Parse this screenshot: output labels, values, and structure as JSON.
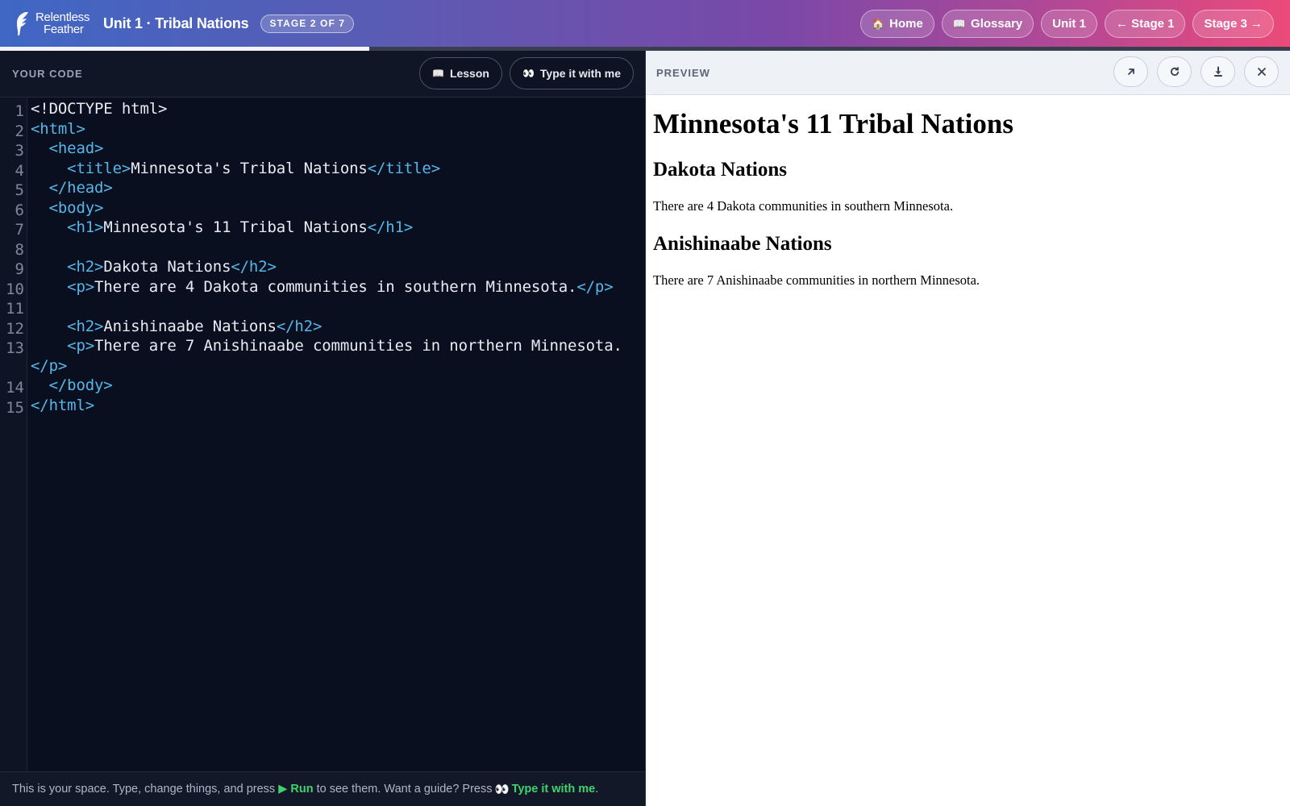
{
  "header": {
    "logo_line1": "Relentless",
    "logo_line2": "Feather",
    "unit_title": "Unit 1 · Tribal Nations",
    "stage_badge": "STAGE 2 OF 7",
    "nav": [
      {
        "icon": "🏠",
        "icon_name": "home-icon",
        "label": "Home"
      },
      {
        "icon": "📖",
        "icon_name": "book-icon",
        "label": "Glossary"
      },
      {
        "icon": "",
        "icon_name": "",
        "label": "Unit 1"
      },
      {
        "icon": "",
        "icon_name": "",
        "label": "← Stage 1"
      },
      {
        "icon": "",
        "icon_name": "",
        "label": "Stage 3 →"
      }
    ],
    "progress_fraction": 0.286
  },
  "editor": {
    "title": "YOUR CODE",
    "buttons": [
      {
        "icon": "📖",
        "icon_name": "book-icon",
        "label": "Lesson"
      },
      {
        "icon": "👀",
        "icon_name": "eyes-icon",
        "label": "Type it with me"
      }
    ],
    "line_numbers": [
      "1",
      "2",
      "3",
      "4",
      "5",
      "6",
      "7",
      "8",
      "9",
      "10",
      "11",
      "12",
      "13",
      "14",
      "15"
    ],
    "code_lines": [
      "<!DOCTYPE html>",
      "<html>",
      "  <head>",
      "    <title>Minnesota's Tribal Nations</title>",
      "  </head>",
      "  <body>",
      "    <h1>Minnesota's 11 Tribal Nations</h1>",
      "",
      "    <h2>Dakota Nations</h2>",
      "    <p>There are 4 Dakota communities in southern Minnesota.</p>",
      "",
      "    <h2>Anishinaabe Nations</h2>",
      "    <p>There are 7 Anishinaabe communities in northern Minnesota.",
      "</p>",
      "  </body>",
      "</html>"
    ],
    "hint": {
      "part1": "This is your space. Type, change things, and press",
      "run_label": "▶ Run",
      "part2": "to see them. Want a guide? Press",
      "eyes": "👀",
      "type_label": "Type it with me",
      "part3": "."
    }
  },
  "preview": {
    "title": "PREVIEW",
    "buttons": [
      "open-external",
      "refresh",
      "download",
      "close"
    ],
    "h1": "Minnesota's 11 Tribal Nations",
    "h2_a": "Dakota Nations",
    "p_a": "There are 4 Dakota communities in southern Minnesota.",
    "h2_b": "Anishinaabe Nations",
    "p_b": "There are 7 Anishinaabe communities in northern Minnesota."
  }
}
